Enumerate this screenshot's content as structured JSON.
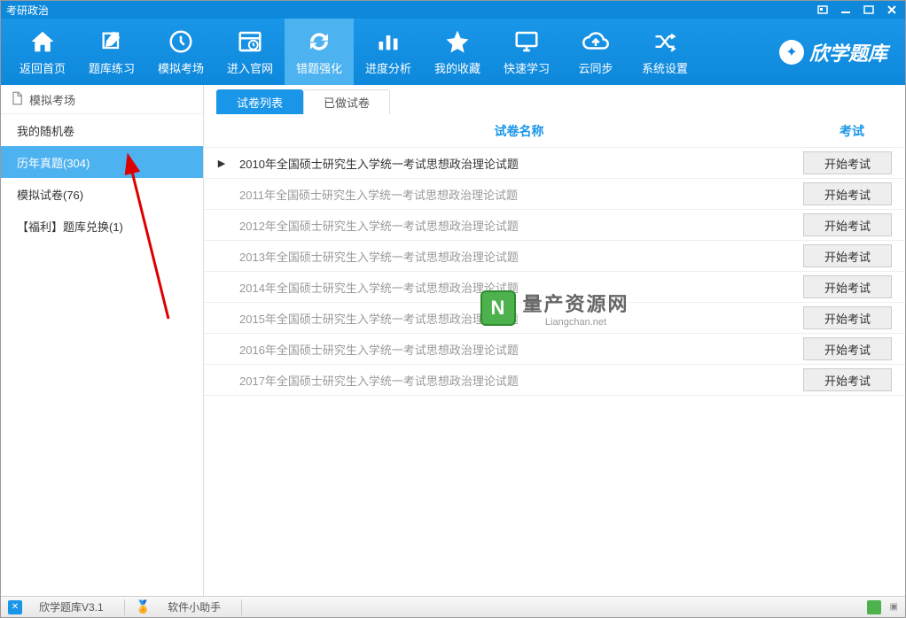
{
  "window_title": "考研政治",
  "toolbar": [
    {
      "label": "返回首页"
    },
    {
      "label": "题库练习"
    },
    {
      "label": "模拟考场"
    },
    {
      "label": "进入官网"
    },
    {
      "label": "错题强化",
      "active": true
    },
    {
      "label": "进度分析"
    },
    {
      "label": "我的收藏"
    },
    {
      "label": "快速学习"
    },
    {
      "label": "云同步"
    },
    {
      "label": "系统设置"
    }
  ],
  "brand": "欣学题库",
  "sidebar": {
    "header": "模拟考场",
    "items": [
      {
        "label": "我的随机卷"
      },
      {
        "label": "历年真题(304)",
        "selected": true
      },
      {
        "label": "模拟试卷(76)"
      },
      {
        "label": "【福利】题库兑换(1)"
      }
    ]
  },
  "tabs": [
    {
      "label": "试卷列表",
      "active": true
    },
    {
      "label": "已做试卷"
    }
  ],
  "list_header": {
    "name": "试卷名称",
    "action": "考试"
  },
  "rows": [
    {
      "name": "2010年全国硕士研究生入学统一考试思想政治理论试题",
      "current": true
    },
    {
      "name": "2011年全国硕士研究生入学统一考试思想政治理论试题"
    },
    {
      "name": "2012年全国硕士研究生入学统一考试思想政治理论试题"
    },
    {
      "name": "2013年全国硕士研究生入学统一考试思想政治理论试题"
    },
    {
      "name": "2014年全国硕士研究生入学统一考试思想政治理论试题"
    },
    {
      "name": "2015年全国硕士研究生入学统一考试思想政治理论试题"
    },
    {
      "name": "2016年全国硕士研究生入学统一考试思想政治理论试题"
    },
    {
      "name": "2017年全国硕士研究生入学统一考试思想政治理论试题"
    }
  ],
  "action_label": "开始考试",
  "watermark": {
    "big": "量产资源网",
    "small": "Liangchan.net"
  },
  "taskbar": {
    "app_name": "欣学题库V3.1",
    "helper": "软件小助手"
  }
}
